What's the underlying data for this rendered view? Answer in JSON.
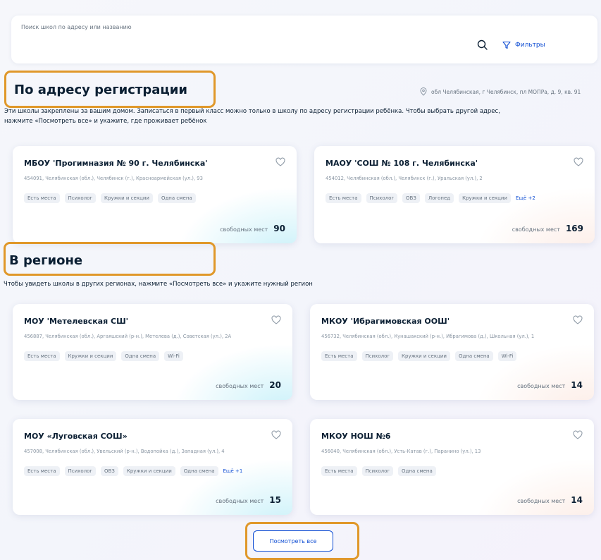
{
  "search": {
    "label": "Поиск школ по адресу или названию",
    "value": "",
    "filters_label": "Фильтры"
  },
  "registration": {
    "title": "По адресу регистрации",
    "address": "обл Челябинская, г Челябинск, пл МОПРа, д. 9, кв. 91",
    "description_line1": "Эти школы закреплены за вашим домом. Записаться в первый класс можно только в школу по адресу регистрации ребёнка. Чтобы выбрать другой адрес,",
    "description_line2": "нажмите «Посмотреть все» и укажите, где проживает ребёнок",
    "schools": [
      {
        "name": "МБОУ 'Прогимназия № 90 г. Челябинска'",
        "address": "454091, Челябинская (обл.), Челябинск (г.), Красноармейская (ул.), 93",
        "tags": [
          "Есть места",
          "Психолог",
          "Кружки и секции",
          "Одна смена"
        ],
        "more": "",
        "seats_label": "свободных мест",
        "seats": "90"
      },
      {
        "name": "МАОУ 'СОШ № 108 г. Челябинска'",
        "address": "454012, Челябинская (обл.), Челябинск (г.), Уральская (ул.), 2",
        "tags": [
          "Есть места",
          "Психолог",
          "ОВЗ",
          "Логопед",
          "Кружки и секции"
        ],
        "more": "Ещё +2",
        "seats_label": "свободных мест",
        "seats": "169"
      }
    ]
  },
  "region": {
    "title": "В регионе",
    "description": "Чтобы увидеть школы в других регионах, нажмите «Посмотреть все» и укажите нужный регион",
    "schools": [
      {
        "name": "МОУ 'Метелевская СШ'",
        "address": "456887, Челябинская (обл.), Аргаяшский (р-н.), Метелева (д.), Советская (ул.), 2А",
        "tags": [
          "Есть места",
          "Кружки и секции",
          "Одна смена",
          "Wi-Fi"
        ],
        "more": "",
        "seats_label": "свободных мест",
        "seats": "20"
      },
      {
        "name": "МКОУ 'Ибрагимовская ООШ'",
        "address": "456732, Челябинская (обл.), Кунашакский (р-н.), Ибрагимова (д.), Школьная (ул.), 1",
        "tags": [
          "Есть места",
          "Психолог",
          "Кружки и секции",
          "Одна смена",
          "Wi-Fi"
        ],
        "more": "",
        "seats_label": "свободных мест",
        "seats": "14"
      },
      {
        "name": "МОУ «Луговская СОШ»",
        "address": "457008, Челябинская (обл.), Увельский (р-н.), Водопойка (д.), Западная (ул.), 4",
        "tags": [
          "Есть места",
          "Психолог",
          "ОВЗ",
          "Кружки и секции",
          "Одна смена"
        ],
        "more": "Ещё +1",
        "seats_label": "свободных мест",
        "seats": "15"
      },
      {
        "name": "МКОУ НОШ №6",
        "address": "456040, Челябинская (обл.), Усть-Катав (г.), Паранино (ул.), 13",
        "tags": [
          "Есть места",
          "Психолог",
          "Одна смена"
        ],
        "more": "",
        "seats_label": "свободных мест",
        "seats": "14"
      }
    ]
  },
  "view_all_label": "Посмотреть все",
  "colors": {
    "accent": "#0d4cd3",
    "highlight": "#e0982a",
    "text": "#0b1f33",
    "muted": "#66727f"
  }
}
